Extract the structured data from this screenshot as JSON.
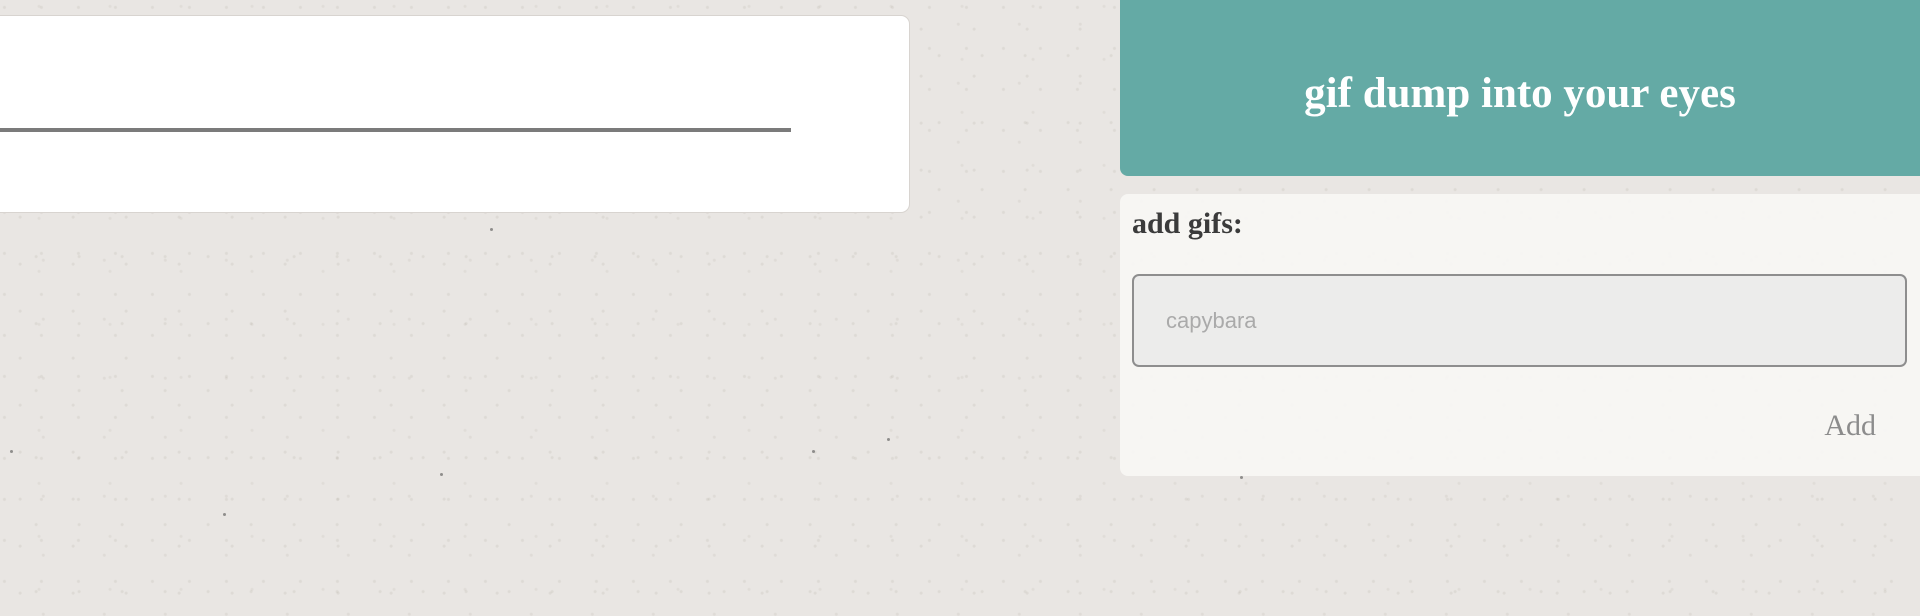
{
  "header": {
    "title": "gif dump into your eyes",
    "background_color": "#64aaa5"
  },
  "add_panel": {
    "heading": "add gifs:",
    "search_input": {
      "value": "",
      "placeholder": "capybara"
    },
    "add_button_label": "Add"
  },
  "colors": {
    "page_background": "#e9e6e3",
    "card_background": "#ffffff",
    "progress_track": "#7b7b7b",
    "button_text": "#8c8c8c"
  }
}
